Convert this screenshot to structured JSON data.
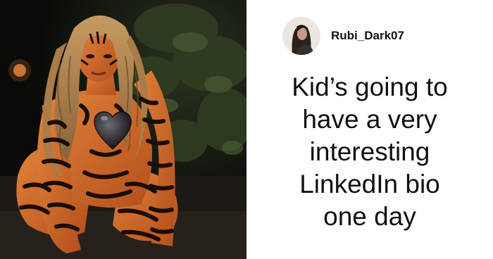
{
  "post": {
    "username": "Rubi_Dark07",
    "comment": "Kid’s going to have a very interesting LinkedIn bio one day",
    "photo_icon": "tiger-costume-photo",
    "avatar_icon": "user-avatar-photo"
  },
  "colors": {
    "background": "#ffffff",
    "text": "#111111",
    "photo_background": "#0d0f0b",
    "tiger_orange": "#d4692a",
    "tiger_stripe": "#1a0c06"
  }
}
